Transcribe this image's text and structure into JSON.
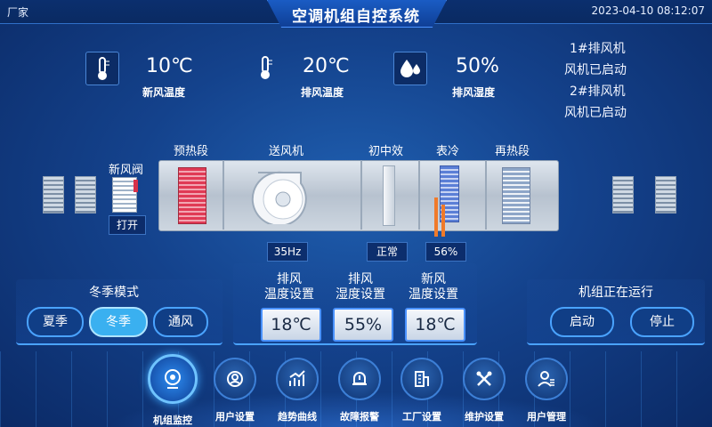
{
  "header": {
    "brand": "厂家",
    "title": "空调机组自控系统",
    "datetime": "2023-04-10 08:12:07"
  },
  "sensors": [
    {
      "icon": "thermometer-icon",
      "value": "10℃",
      "label": "新风温度"
    },
    {
      "icon": "thermometer-icon",
      "value": "20℃",
      "label": "排风温度"
    },
    {
      "icon": "water-drop-icon",
      "value": "50%",
      "label": "排风湿度"
    }
  ],
  "fans": [
    {
      "name": "1#排风机",
      "status": "风机已启动"
    },
    {
      "name": "2#排风机",
      "status": "风机已启动"
    }
  ],
  "ahu": {
    "sections": {
      "damper": "新风阀",
      "preheat": "预热段",
      "supply_fan": "送风机",
      "filter": "初中效",
      "cooling_coil": "表冷",
      "reheat": "再热段"
    },
    "readouts": {
      "damper": "打开",
      "fan_freq": "35Hz",
      "filter": "正常",
      "valve": "56%"
    }
  },
  "setpoints": [
    {
      "label": "排风\n温度设置",
      "value": "18℃"
    },
    {
      "label": "排风\n湿度设置",
      "value": "55%"
    },
    {
      "label": "新风\n温度设置",
      "value": "18℃"
    }
  ],
  "mode_panel": {
    "title": "冬季模式",
    "buttons": [
      {
        "label": "夏季",
        "active": false
      },
      {
        "label": "冬季",
        "active": true
      },
      {
        "label": "通风",
        "active": false
      }
    ]
  },
  "run_panel": {
    "status": "机组正在运行",
    "start": "启动",
    "stop": "停止"
  },
  "nav": [
    {
      "icon": "camera-icon",
      "label": "机组监控"
    },
    {
      "icon": "user-settings-icon",
      "label": "用户设置"
    },
    {
      "icon": "trend-chart-icon",
      "label": "趋势曲线"
    },
    {
      "icon": "alarm-bell-icon",
      "label": "故障报警"
    },
    {
      "icon": "building-icon",
      "label": "工厂设置"
    },
    {
      "icon": "tools-icon",
      "label": "维护设置"
    },
    {
      "icon": "user-manage-icon",
      "label": "用户管理"
    }
  ],
  "colors": {
    "accent": "#4aa3ff",
    "active_button": "#3ab0f0",
    "heater": "#d8324a",
    "valve": "#f07a2a"
  }
}
